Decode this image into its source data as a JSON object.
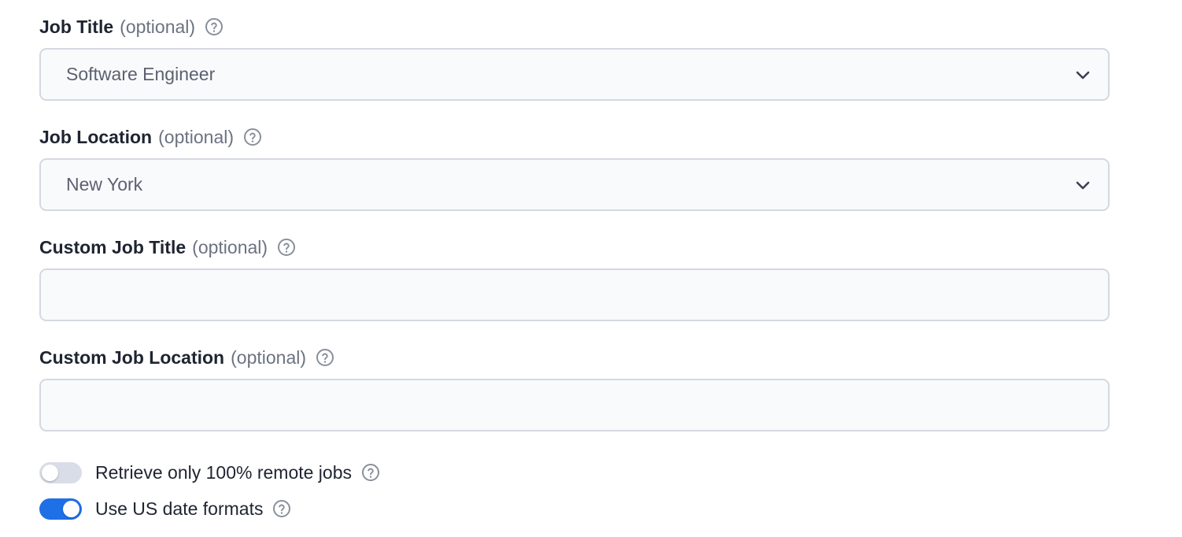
{
  "fields": [
    {
      "label": "Job Title",
      "optional": "(optional)",
      "value": "Software Engineer",
      "type": "select"
    },
    {
      "label": "Job Location",
      "optional": "(optional)",
      "value": "New York",
      "type": "select"
    },
    {
      "label": "Custom Job Title",
      "optional": "(optional)",
      "value": "",
      "type": "text"
    },
    {
      "label": "Custom Job Location",
      "optional": "(optional)",
      "value": "",
      "type": "text"
    }
  ],
  "toggles": [
    {
      "label": "Retrieve only 100% remote jobs",
      "state": "off"
    },
    {
      "label": "Use US date formats",
      "state": "on"
    }
  ],
  "colors": {
    "accent": "#1f6fe6",
    "toggle_off": "#d9dde8",
    "field_border": "#d4d8e1",
    "field_bg": "#f9fafc",
    "help_icon": "#8a8f9a"
  },
  "icons": {
    "help": "question-circle-icon",
    "dropdown": "chevron-down-icon"
  }
}
